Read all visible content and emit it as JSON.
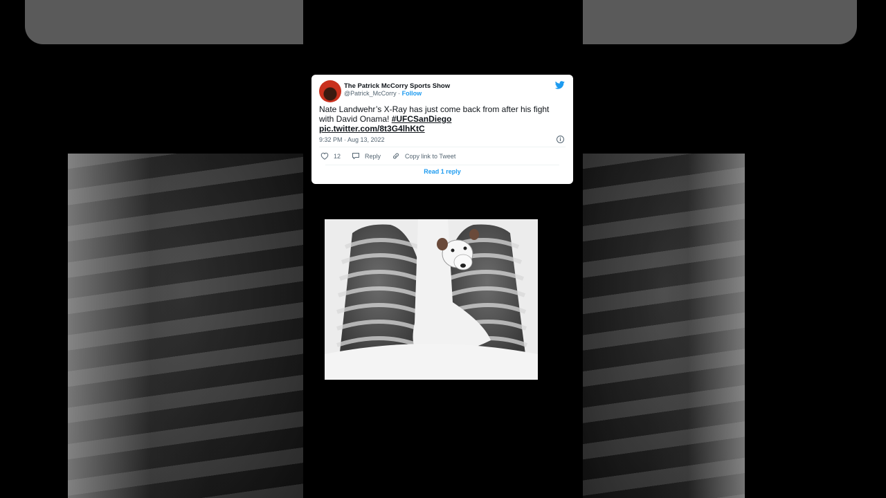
{
  "tweet": {
    "author_name": "The Patrick McCorry Sports Show",
    "author_handle": "@Patrick_McCorry",
    "separator": " · ",
    "follow_label": "Follow",
    "text_plain": "Nate Landwehr’s X-Ray has just come back from after his fight with David Onama!",
    "hashtag": "#UFCSanDiego",
    "pic_link": "pic.twitter.com/8t3G4lhKtC",
    "timestamp": "9:32 PM · Aug 13, 2022",
    "like_count": "12",
    "reply_label": "Reply",
    "copy_link_label": "Copy link to Tweet",
    "read_replies_label": "Read 1 reply"
  },
  "icons": {
    "brand": "twitter-bird-icon",
    "info": "info-icon",
    "like": "heart-icon",
    "reply": "reply-icon",
    "copy": "link-icon"
  },
  "colors": {
    "accent": "#1d9bf0",
    "text": "#0f1419",
    "muted": "#536471",
    "background": "#000000"
  }
}
